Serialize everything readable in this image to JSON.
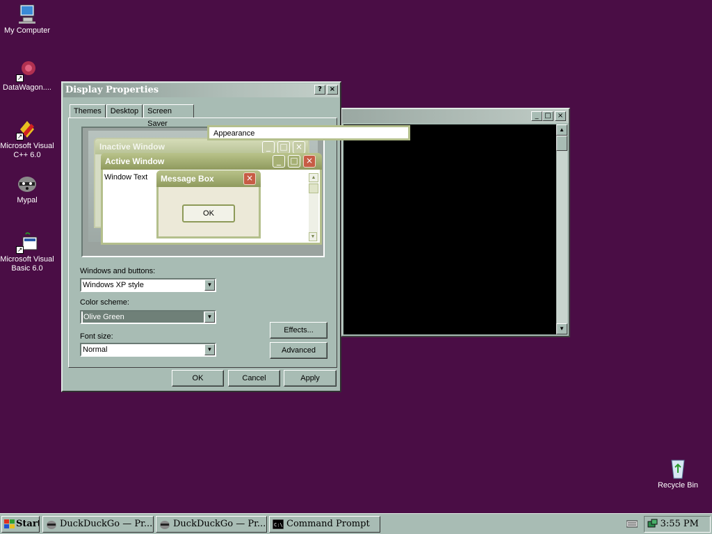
{
  "desktop": {
    "icons": [
      {
        "label": "My Computer"
      },
      {
        "label": "DataWagon...."
      },
      {
        "label": "Microsoft Visual C++ 6.0"
      },
      {
        "label": "Mypal"
      },
      {
        "label": "Microsoft Visual Basic 6.0"
      },
      {
        "label": "Recycle Bin"
      }
    ]
  },
  "console": {
    "buttons": {
      "minimize": "_",
      "maximize": "□",
      "close": "×"
    }
  },
  "dialog": {
    "title": "Display Properties",
    "title_buttons": {
      "help": "?",
      "close": "×"
    },
    "tabs": [
      {
        "label": "Themes"
      },
      {
        "label": "Desktop"
      },
      {
        "label": "Screen Saver"
      },
      {
        "label": "Appearance"
      }
    ],
    "active_tab": "Appearance",
    "preview": {
      "inactive_title": "Inactive Window",
      "active_title": "Active Window",
      "window_text": "Window Text",
      "message_title": "Message Box",
      "message_ok": "OK"
    },
    "windows_and_buttons": {
      "label": "Windows and buttons:",
      "value": "Windows XP style"
    },
    "color_scheme": {
      "label": "Color scheme:",
      "value": "Olive Green"
    },
    "font_size": {
      "label": "Font size:",
      "value": "Normal"
    },
    "effects_label": "Effects...",
    "advanced_label": "Advanced",
    "ok_label": "OK",
    "cancel_label": "Cancel",
    "apply_label": "Apply"
  },
  "taskbar": {
    "start_label": "Start",
    "items": [
      {
        "label": "DuckDuckGo — Pr..."
      },
      {
        "label": "DuckDuckGo — Pr..."
      },
      {
        "label": "Command Prompt"
      }
    ],
    "clock": "3:55 PM"
  }
}
